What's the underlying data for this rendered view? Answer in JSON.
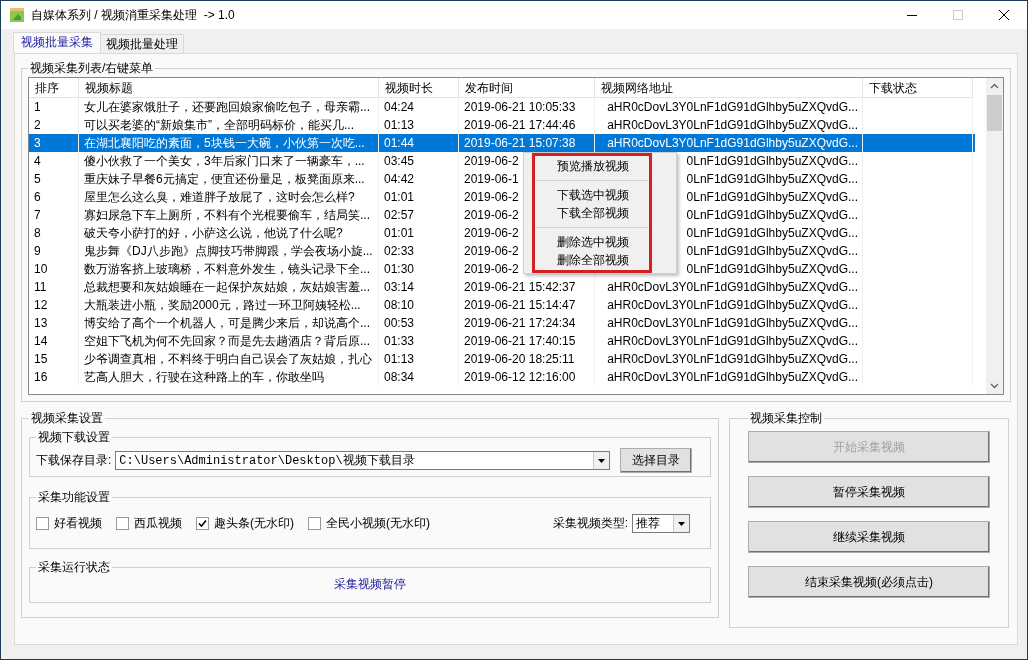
{
  "window": {
    "title": "自媒体系列 / 视频消重采集处理  -> 1.0"
  },
  "tabs": [
    {
      "label": "视频批量采集",
      "selected": true
    },
    {
      "label": "视频批量处理",
      "selected": false
    }
  ],
  "list_group": {
    "title": "视频采集列表/右键菜单",
    "columns": [
      "排序",
      "视频标题",
      "视频时长",
      "发布时间",
      "视频网络地址",
      "下载状态"
    ],
    "rows": [
      {
        "index": "1",
        "title": "女儿在婆家饿肚子，还要跑回娘家偷吃包子，母亲霸...",
        "duration": "04:24",
        "published": "2019-06-21 10:05:33",
        "url": "aHR0cDovL3Y0LnF1dG91dGlhby5uZXQvdG...",
        "selected": false
      },
      {
        "index": "2",
        "title": "可以买老婆的“新娘集市”，全部明码标价，能买几...",
        "duration": "01:13",
        "published": "2019-06-21 17:44:46",
        "url": "aHR0cDovL3Y0LnF1dG91dGlhby5uZXQvdG...",
        "selected": false
      },
      {
        "index": "3",
        "title": "在湖北襄阳吃的素面，5块钱一大碗，小伙第一次吃...",
        "duration": "01:44",
        "published": "2019-06-21 15:07:38",
        "url": "aHR0cDovL3Y0LnF1dG91dGlhby5uZXQvdG...",
        "selected": true
      },
      {
        "index": "4",
        "title": "傻小伙救了一个美女，3年后家门口来了一辆豪车，...",
        "duration": "03:45",
        "published": "2019-06-2",
        "url": "0LnF1dG91dGlhby5uZXQvdG...",
        "selected": false
      },
      {
        "index": "5",
        "title": "重庆妹子早餐6元搞定，便宜还份量足，板凳面原来...",
        "duration": "04:42",
        "published": "2019-06-1",
        "url": "0LnF1dG91dGlhby5uZXQvdG...",
        "selected": false
      },
      {
        "index": "6",
        "title": "屋里怎么这么臭，难道胖子放屁了，这时会怎么样?",
        "duration": "01:01",
        "published": "2019-06-2",
        "url": "0LnF1dG91dGlhby5uZXQvdG...",
        "selected": false
      },
      {
        "index": "7",
        "title": "寡妇尿急下车上厕所，不料有个光棍要偷车，结局笑...",
        "duration": "02:57",
        "published": "2019-06-2",
        "url": "0LnF1dG91dGlhby5uZXQvdG...",
        "selected": false
      },
      {
        "index": "8",
        "title": "破天夸小萨打的好，小萨这么说，他说了什么呢?",
        "duration": "01:01",
        "published": "2019-06-2",
        "url": "0LnF1dG91dGlhby5uZXQvdG...",
        "selected": false
      },
      {
        "index": "9",
        "title": "鬼步舞《DJ八步跑》点脚技巧带脚跟，学会夜场小旋...",
        "duration": "02:33",
        "published": "2019-06-2",
        "url": "0LnF1dG91dGlhby5uZXQvdG...",
        "selected": false
      },
      {
        "index": "10",
        "title": "数万游客挤上玻璃桥，不料意外发生，镜头记录下全...",
        "duration": "01:30",
        "published": "2019-06-2",
        "url": "0LnF1dG91dGlhby5uZXQvdG...",
        "selected": false
      },
      {
        "index": "11",
        "title": "总裁想要和灰姑娘睡在一起保护灰姑娘，灰姑娘害羞...",
        "duration": "03:14",
        "published": "2019-06-21 15:42:37",
        "url": "aHR0cDovL3Y0LnF1dG91dGlhby5uZXQvdG...",
        "selected": false
      },
      {
        "index": "12",
        "title": "大瓶装进小瓶，奖励2000元，路过一环卫阿姨轻松...",
        "duration": "08:10",
        "published": "2019-06-21 15:14:47",
        "url": "aHR0cDovL3Y0LnF1dG91dGlhby5uZXQvdG...",
        "selected": false
      },
      {
        "index": "13",
        "title": "博安给了高个一个机器人，可是腾少来后，却说高个...",
        "duration": "00:53",
        "published": "2019-06-21 17:24:34",
        "url": "aHR0cDovL3Y0LnF1dG91dGlhby5uZXQvdG...",
        "selected": false
      },
      {
        "index": "14",
        "title": "空姐下飞机为何不先回家？而是先去趟酒店？背后原...",
        "duration": "01:33",
        "published": "2019-06-21 17:40:15",
        "url": "aHR0cDovL3Y0LnF1dG91dGlhby5uZXQvdG...",
        "selected": false
      },
      {
        "index": "15",
        "title": "少爷调查真相，不料终于明白自己误会了灰姑娘，扎心",
        "duration": "01:13",
        "published": "2019-06-20 18:25:11",
        "url": "aHR0cDovL3Y0LnF1dG91dGlhby5uZXQvdG...",
        "selected": false
      },
      {
        "index": "16",
        "title": "艺高人胆大，行驶在这种路上的车，你敢坐吗",
        "duration": "08:34",
        "published": "2019-06-12 12:16:00",
        "url": "aHR0cDovL3Y0LnF1dG91dGlhby5uZXQvdG...",
        "selected": false
      }
    ],
    "context_menu": {
      "items": [
        {
          "kind": "item",
          "label": "预览播放视频"
        },
        {
          "kind": "separator"
        },
        {
          "kind": "item",
          "label": "下载选中视频"
        },
        {
          "kind": "item",
          "label": "下载全部视频"
        },
        {
          "kind": "separator"
        },
        {
          "kind": "item",
          "label": "删除选中视频"
        },
        {
          "kind": "item",
          "label": "删除全部视频"
        }
      ]
    }
  },
  "settings": {
    "title": "视频采集设置",
    "download": {
      "title": "视频下载设置",
      "label": "下载保存目录:",
      "path": "C:\\Users\\Administrator\\Desktop\\视频下载目录",
      "button": "选择目录"
    },
    "features": {
      "title": "采集功能设置",
      "options": [
        {
          "label": "好看视频",
          "checked": false
        },
        {
          "label": "西瓜视频",
          "checked": false
        },
        {
          "label": "趣头条(无水印)",
          "checked": true
        },
        {
          "label": "全民小视频(无水印)",
          "checked": false
        }
      ],
      "type_label": "采集视频类型:",
      "type_value": "推荐"
    },
    "status": {
      "title": "采集运行状态",
      "text": "采集视频暂停"
    }
  },
  "control": {
    "title": "视频采集控制",
    "buttons": [
      {
        "label": "开始采集视频",
        "disabled": true
      },
      {
        "label": "暂停采集视频",
        "disabled": false
      },
      {
        "label": "继续采集视频",
        "disabled": false
      },
      {
        "label": "结束采集视频(必须点击)",
        "disabled": false
      }
    ]
  }
}
